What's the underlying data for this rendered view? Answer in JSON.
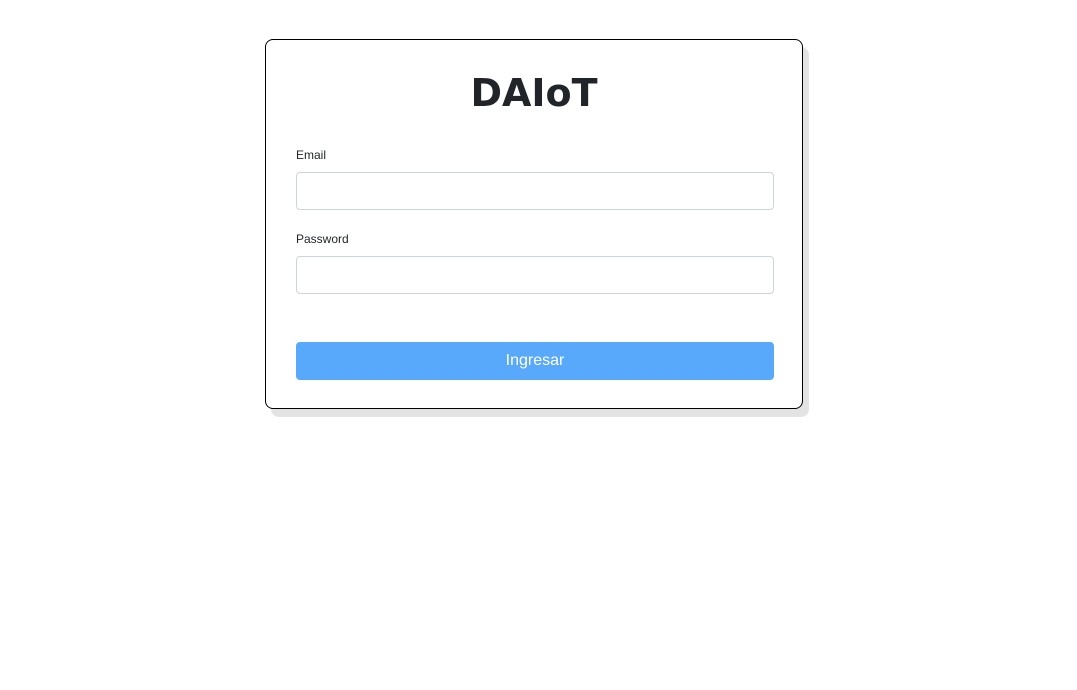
{
  "login": {
    "title": "DAIoT",
    "email": {
      "label": "Email",
      "value": "",
      "placeholder": ""
    },
    "password": {
      "label": "Password",
      "value": "",
      "placeholder": ""
    },
    "submit_label": "Ingresar"
  },
  "colors": {
    "primary_button": "#58a9fb",
    "title_text": "#212529",
    "card_border": "#000000",
    "input_border": "#ced4da"
  }
}
